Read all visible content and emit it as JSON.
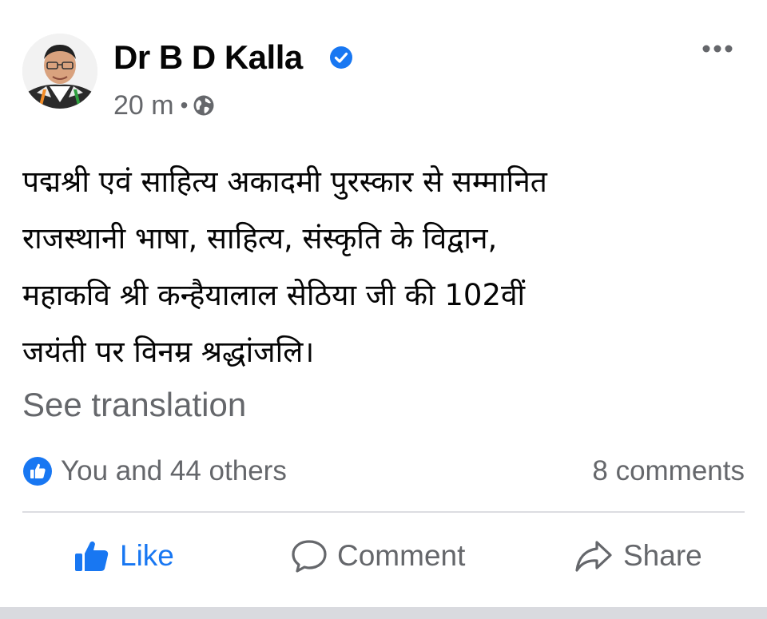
{
  "post": {
    "author": {
      "name": "Dr B D Kalla",
      "verified_icon": "verified-badge-icon"
    },
    "meta": {
      "time": "20 m",
      "separator": "•",
      "audience_icon": "globe-icon"
    },
    "text_lines": [
      "पद्मश्री एवं साहित्य अकादमी पुरस्कार से सम्मानित",
      "राजस्थानी भाषा, साहित्य, संस्कृति के विद्वान,",
      "महाकवि श्री कन्हैयालाल सेठिया जी की 102वीं",
      "जयंती पर विनम्र श्रद्धांजलि।"
    ],
    "see_translation": "See translation",
    "reactions": {
      "summary": "You and 44 others",
      "icon": "like-reaction-icon"
    },
    "comments_count": "8 comments",
    "actions": {
      "like": "Like",
      "comment": "Comment",
      "share": "Share"
    },
    "colors": {
      "brand_blue": "#1877f2",
      "secondary_text": "#65676b",
      "primary_text": "#050505"
    }
  }
}
